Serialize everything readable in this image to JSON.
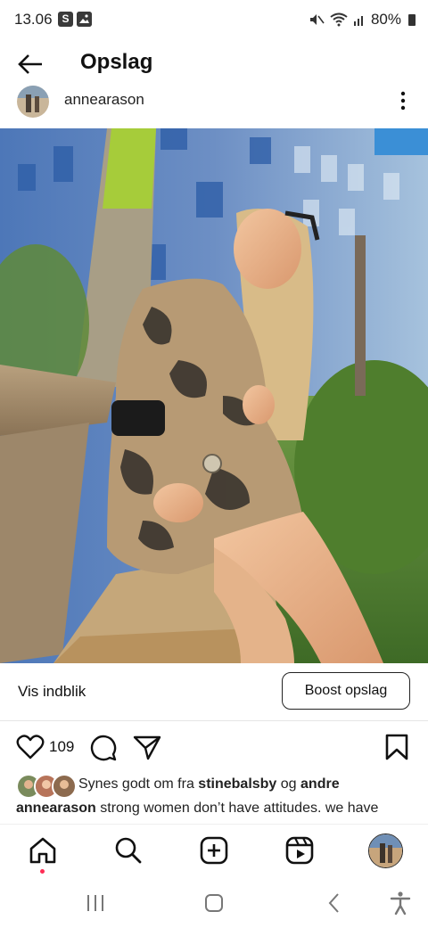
{
  "status_bar": {
    "time": "13.06",
    "notif_s": "S",
    "battery_percent": "80%",
    "icons": [
      "mute-icon",
      "wifi-icon",
      "signal-icon",
      "battery-icon"
    ]
  },
  "header": {
    "title": "Opslag"
  },
  "post": {
    "username": "annearason",
    "insights_label": "Vis indblik",
    "boost_label": "Boost opslag",
    "like_count": "109",
    "likes_prefix": "Synes godt om fra ",
    "likes_user": "stinebalsby",
    "likes_joiner": " og ",
    "likes_others": "andre",
    "caption_user": "annearason",
    "caption_text": " strong women don’t have attitudes. we have"
  },
  "bottom_nav": {
    "items": [
      "home-icon",
      "search-icon",
      "create-icon",
      "reels-icon",
      "profile-avatar"
    ]
  },
  "system_nav": {
    "items": [
      "recent-apps-icon",
      "home-button-icon",
      "back-icon",
      "accessibility-icon"
    ]
  },
  "colors": {
    "notification_dot": "#ff2d55",
    "text": "#111111"
  }
}
